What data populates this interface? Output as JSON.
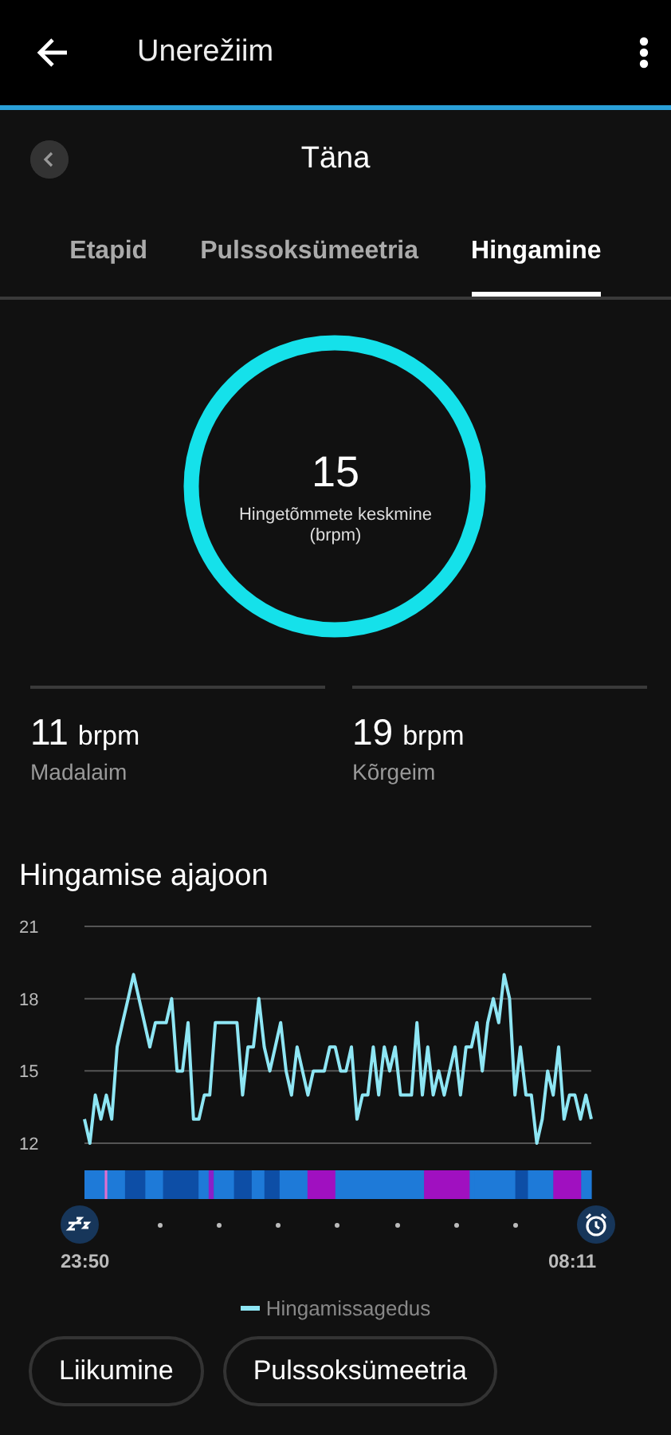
{
  "app_bar": {
    "title": "Unerežiim"
  },
  "date_nav": {
    "label": "Täna"
  },
  "tabs": [
    {
      "label": "Etapid",
      "selected": false
    },
    {
      "label": "Pulssoksümeetria",
      "selected": false
    },
    {
      "label": "Hingamine",
      "selected": true
    }
  ],
  "summary": {
    "value": "15",
    "label": "Hingetõmmete keskmine (brpm)"
  },
  "stats": [
    {
      "value": "11",
      "unit": "brpm",
      "label": "Madalaim"
    },
    {
      "value": "19",
      "unit": "brpm",
      "label": "Kõrgeim"
    }
  ],
  "timeline": {
    "title": "Hingamise ajajoon",
    "start_time": "23:50",
    "end_time": "08:11",
    "chart_data": {
      "type": "line",
      "ylim": [
        12,
        21
      ],
      "yticks": [
        12,
        15,
        18,
        21
      ],
      "series": [
        {
          "name": "Hingamissagedus",
          "color": "#8ee6f4",
          "values": [
            13,
            12,
            14,
            13,
            14,
            13,
            16,
            17,
            18,
            19,
            18,
            17,
            16,
            17,
            17,
            17,
            18,
            15,
            15,
            17,
            13,
            13,
            14,
            14,
            17,
            17,
            17,
            17,
            17,
            14,
            16,
            16,
            18,
            16,
            15,
            16,
            17,
            15,
            14,
            16,
            15,
            14,
            15,
            15,
            15,
            16,
            16,
            15,
            15,
            16,
            13,
            14,
            14,
            16,
            14,
            16,
            15,
            16,
            14,
            14,
            14,
            17,
            14,
            16,
            14,
            15,
            14,
            15,
            16,
            14,
            16,
            16,
            17,
            15,
            17,
            18,
            17,
            19,
            18,
            14,
            16,
            14,
            14,
            12,
            13,
            15,
            14,
            16,
            13,
            14,
            14,
            13,
            14,
            13
          ]
        }
      ]
    }
  },
  "chips": [
    {
      "label": "Liikumine"
    },
    {
      "label": "Pulssoksümeetria"
    }
  ]
}
